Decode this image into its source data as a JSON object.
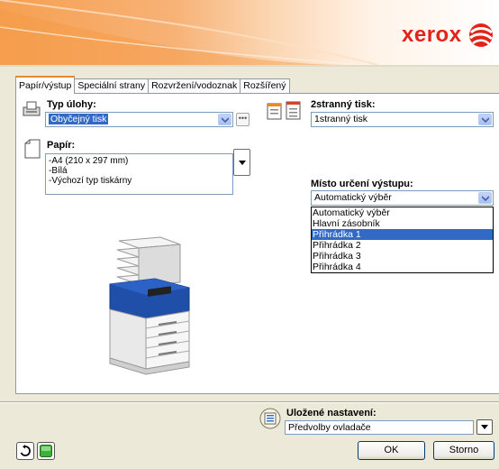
{
  "brand": {
    "logo_text": "xerox",
    "color": "#e2231a"
  },
  "tabs": [
    {
      "label": "Papír/výstup",
      "active": true
    },
    {
      "label": "Speciální strany",
      "active": false
    },
    {
      "label": "Rozvržení/vodoznak",
      "active": false
    },
    {
      "label": "Rozšířený",
      "active": false
    }
  ],
  "job_type": {
    "label": "Typ úlohy:",
    "value": "Obyčejný tisk",
    "more": "•••"
  },
  "paper": {
    "label": "Papír:",
    "lines": [
      "-A4 (210 x 297 mm)",
      "-Bílá",
      "-Výchozí typ tiskárny"
    ]
  },
  "duplex": {
    "label": "2stranný tisk:",
    "value": "1stranný tisk"
  },
  "output_destination": {
    "label": "Místo určení výstupu:",
    "value": "Automatický výběr",
    "options": [
      "Automatický výběr",
      "Hlavní zásobník",
      "Přihrádka 1",
      "Přihrádka 2",
      "Přihrádka 3",
      "Přihrádka 4"
    ],
    "highlighted_index": 2
  },
  "saved_settings": {
    "label": "Uložené nastavení:",
    "value": "Předvolby ovladače"
  },
  "buttons": {
    "ok": "OK",
    "cancel": "Storno"
  },
  "colors": {
    "accent_tab": "#e68b2c",
    "selection": "#316ac5",
    "printer_blue": "#1f4fa8"
  }
}
